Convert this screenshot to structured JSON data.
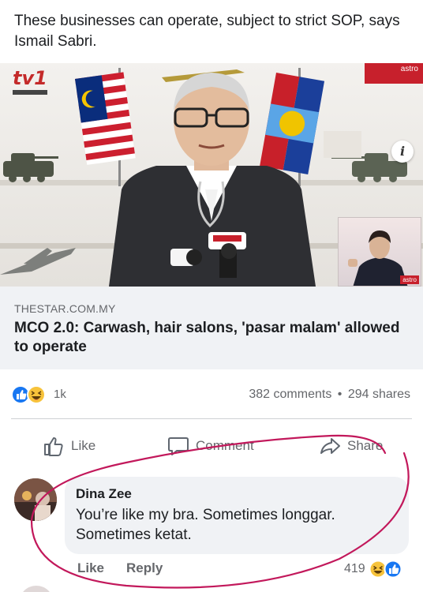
{
  "post": {
    "text": "These businesses can operate, subject to strict SOP, says Ismail Sabri."
  },
  "media": {
    "channel_logo": "tv1",
    "brand_badge": "astro",
    "inset_brand": "astro",
    "info_icon": "i"
  },
  "link_preview": {
    "domain": "THESTAR.COM.MY",
    "title": "MCO 2.0: Carwash, hair salons, 'pasar malam' allowed to operate"
  },
  "reactions": {
    "icons": [
      "like-icon",
      "haha-icon"
    ],
    "count": "1k",
    "comments": "382 comments",
    "separator": "•",
    "shares": "294 shares"
  },
  "actions": {
    "like": "Like",
    "comment": "Comment",
    "share": "Share"
  },
  "comment": {
    "author": "Dina Zee",
    "body": "You’re like my bra. Sometimes longgar. Sometimes ketat.",
    "like": "Like",
    "reply": "Reply",
    "reaction_count": "419",
    "reaction_icons": [
      "haha-icon",
      "like-icon"
    ]
  },
  "colors": {
    "facebook_blue": "#1877f2",
    "haha_yellow": "#f7c33b",
    "annotation_red": "#c2185b",
    "muted_text": "#65676b",
    "bubble_bg": "#f0f2f5"
  }
}
